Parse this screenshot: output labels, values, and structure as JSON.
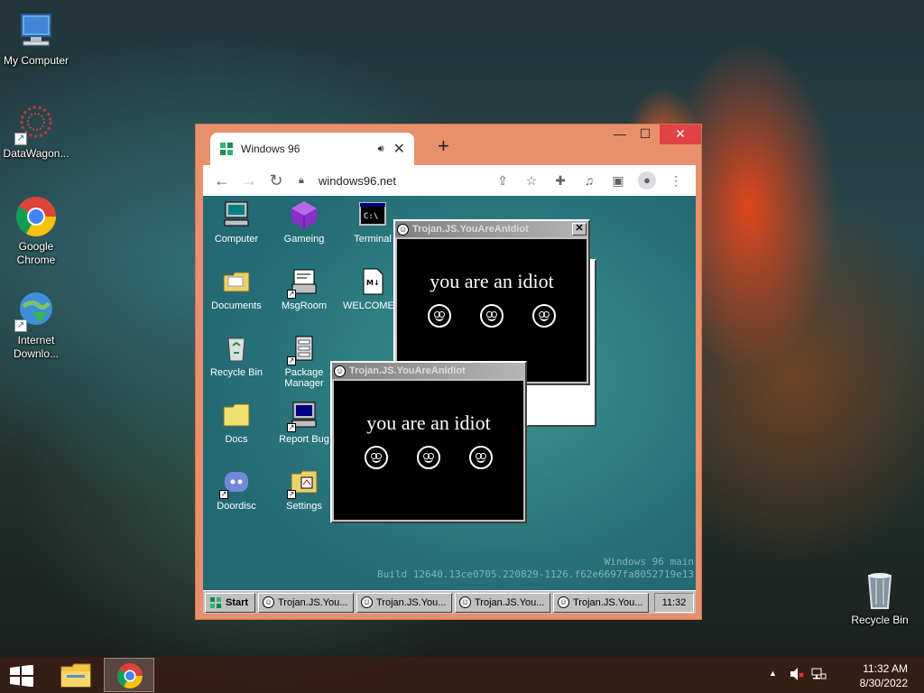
{
  "host_desktop": {
    "icons": [
      {
        "label": "My Computer"
      },
      {
        "label": "DataWagon..."
      },
      {
        "label": "Google Chrome"
      },
      {
        "label": "Internet Downlo..."
      },
      {
        "label": "Recycle Bin"
      }
    ]
  },
  "browser": {
    "tab_title": "Windows 96",
    "new_tab_label": "+",
    "url": "windows96.net",
    "controls": {
      "minimize": "—",
      "maximize": "☐",
      "close": "✕"
    }
  },
  "w96": {
    "desktop_icons": [
      {
        "label": "Computer"
      },
      {
        "label": "Gameing"
      },
      {
        "label": "Terminal"
      },
      {
        "label": "Documents"
      },
      {
        "label": "MsgRoom"
      },
      {
        "label": "WELCOME..."
      },
      {
        "label": "Recycle Bin"
      },
      {
        "label": "Package Manager"
      },
      {
        "label": "Docs"
      },
      {
        "label": "Report Bug"
      },
      {
        "label": "Doordisc"
      },
      {
        "label": "Settings"
      }
    ],
    "popup_title": "Trojan.JS.YouAreAnIdiot",
    "popup_text": "you are an idiot",
    "build_line1": "Windows 96 main",
    "build_line2": "Build 12640.13ce0705.220829-1126.f62e6697fa8052719e13",
    "taskbar": {
      "start_label": "Start",
      "tasks": [
        "Trojan.JS.You...",
        "Trojan.JS.You...",
        "Trojan.JS.You...",
        "Trojan.JS.You..."
      ],
      "clock": "11:32"
    }
  },
  "taskbar": {
    "time": "11:32 AM",
    "date": "8/30/2022",
    "tray_arrow": "▲"
  }
}
